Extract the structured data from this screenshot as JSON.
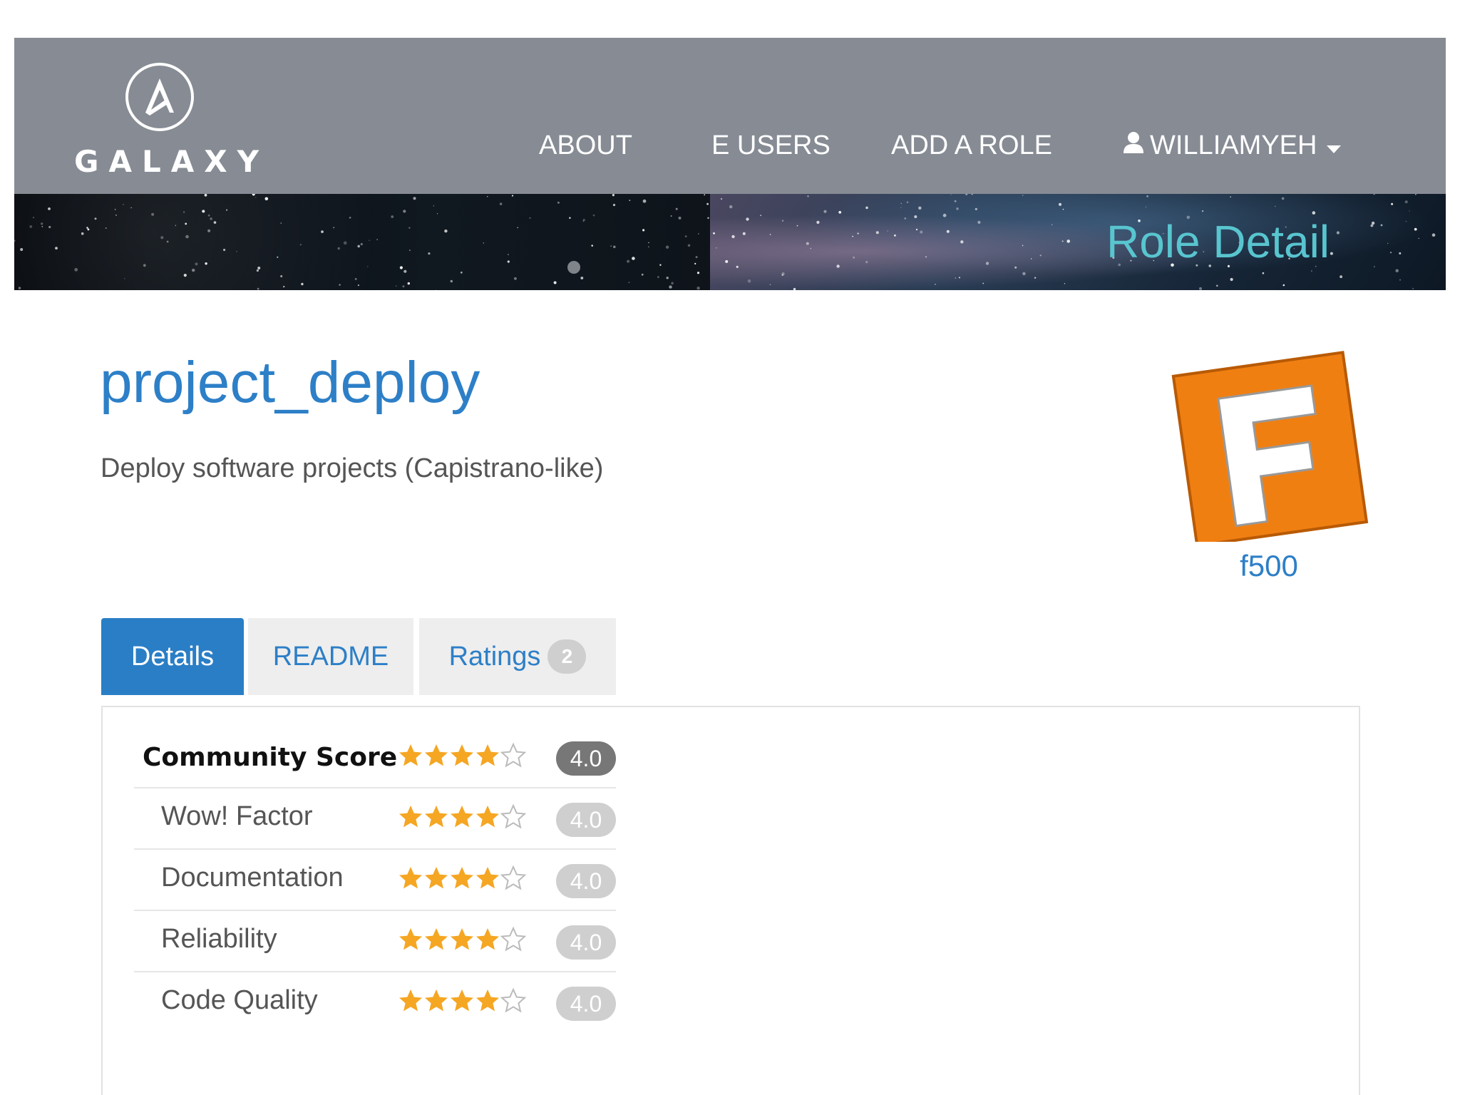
{
  "brand": {
    "name": "GALAXY"
  },
  "nav": {
    "about": "ABOUT",
    "users": "E USERS",
    "add_role": "ADD A ROLE",
    "user": "WILLIAMYEH"
  },
  "banner": {
    "title": "Role Detail"
  },
  "role": {
    "name": "project_deploy",
    "description": "Deploy software projects (Capistrano-like)",
    "owner": "f500",
    "owner_logo_letter": "F"
  },
  "tabs": {
    "details": "Details",
    "readme": "README",
    "ratings": "Ratings",
    "ratings_count": "2",
    "active": "Details"
  },
  "scores": [
    {
      "label": "Community Score",
      "stars": 4,
      "max": 5,
      "value": "4.0"
    },
    {
      "label": "Wow! Factor",
      "stars": 4,
      "max": 5,
      "value": "4.0"
    },
    {
      "label": "Documentation",
      "stars": 4,
      "max": 5,
      "value": "4.0"
    },
    {
      "label": "Reliability",
      "stars": 4,
      "max": 5,
      "value": "4.0"
    },
    {
      "label": "Code Quality",
      "stars": 4,
      "max": 5,
      "value": "4.0"
    }
  ],
  "colors": {
    "navbar": "#868b94",
    "link": "#2d7fc7",
    "active_tab": "#2a7ec6",
    "banner_title": "#58c5cf",
    "star": "#f5a623",
    "owner_logo": "#f07f12"
  },
  "icons": {
    "brand": "galaxy-logo-icon",
    "user": "user-icon",
    "caret": "caret-down-icon",
    "star": "star-icon"
  }
}
